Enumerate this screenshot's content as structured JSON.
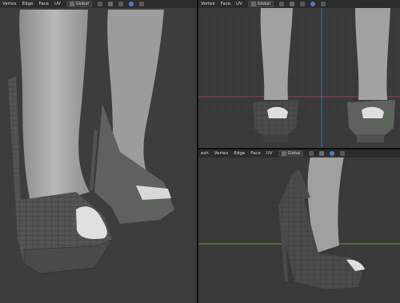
{
  "left_viewport": {
    "menu": [
      "Vertex",
      "Edge",
      "Face",
      "UV"
    ],
    "orientation": "Global"
  },
  "top_right_viewport": {
    "menu": [
      "Vertex",
      "Face",
      "UV"
    ],
    "orientation": "Global"
  },
  "bottom_right_viewport": {
    "menu": [
      "esh",
      "Vertex",
      "Edge",
      "Face",
      "UV"
    ],
    "orientation": "Global"
  },
  "icons": {
    "view_icon": "grid-icon",
    "snap_icon": "magnet-icon",
    "proportional_icon": "circle-icon",
    "transform_pivot_icon": "pivot-icon"
  },
  "colors": {
    "background_left": "#3d3d3d",
    "grid_background": "#393939",
    "x_axis": "#9b3b4b",
    "y_axis": "#6b9a2e",
    "z_axis": "#3d6eaa",
    "mesh_light": "#a9a9a9",
    "mesh_dark": "#505550",
    "selected_mesh": "#4a4a4a"
  }
}
